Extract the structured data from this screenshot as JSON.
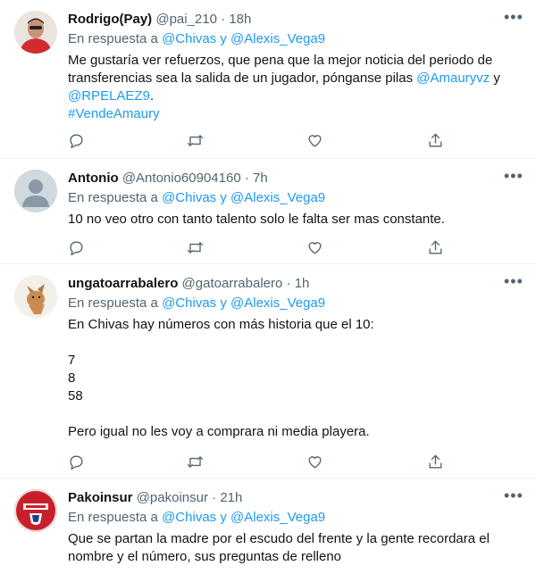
{
  "tweets": [
    {
      "name": "Rodrigo(Pay)",
      "handle": "@pai_210",
      "sep": "·",
      "time": "18h",
      "reply_prefix": "En respuesta a",
      "reply_user1": "@Chivas",
      "reply_join": "y",
      "reply_user2": "@Alexis_Vega9",
      "text_line1": "Me gustaría ver refuerzos, que pena que la mejor noticia del periodo de",
      "text_line2a": "transferencias sea la salida de un jugador, pónganse pilas",
      "mention1": "@Amauryvz",
      "text_line2b": "y",
      "mention2": "@RPELAEZ9",
      "text_line3b": ".",
      "hashtag": "#VendeAmaury",
      "more_icon": "more-horizontal-icon"
    },
    {
      "name": "Antonio",
      "handle": "@Antonio60904160",
      "sep": "·",
      "time": "7h",
      "reply_prefix": "En respuesta a",
      "reply_user1": "@Chivas",
      "reply_join": "y",
      "reply_user2": "@Alexis_Vega9",
      "text_line1": "10 no veo otro con tanto talento solo le falta ser mas constante."
    },
    {
      "name": "ungatoarrabalero",
      "handle": "@gatoarrabalero",
      "sep": "·",
      "time": "1h",
      "reply_prefix": "En respuesta a",
      "reply_user1": "@Chivas",
      "reply_join": "y",
      "reply_user2": "@Alexis_Vega9",
      "text_line1": "En Chivas hay números con más historia que el 10:",
      "text_line2": "7",
      "text_line3": "8",
      "text_line4": "58",
      "text_line5": "Pero igual no les voy a comprara ni media playera."
    },
    {
      "name": "Pakoinsur",
      "handle": "@pakoinsur",
      "sep": "·",
      "time": "21h",
      "reply_prefix": "En respuesta a",
      "reply_user1": "@Chivas",
      "reply_join": "y",
      "reply_user2": "@Alexis_Vega9",
      "text_line1": "Que se partan la madre por el escudo del frente y la gente recordara el",
      "text_line2": "nombre y el número, sus preguntas de relleno"
    }
  ],
  "colors": {
    "link": "#1d9bf0",
    "secondary": "#536471",
    "primary": "#0f1419",
    "divider": "#eff3f4"
  },
  "action_icons": [
    "reply-icon",
    "retweet-icon",
    "like-icon",
    "share-icon"
  ]
}
